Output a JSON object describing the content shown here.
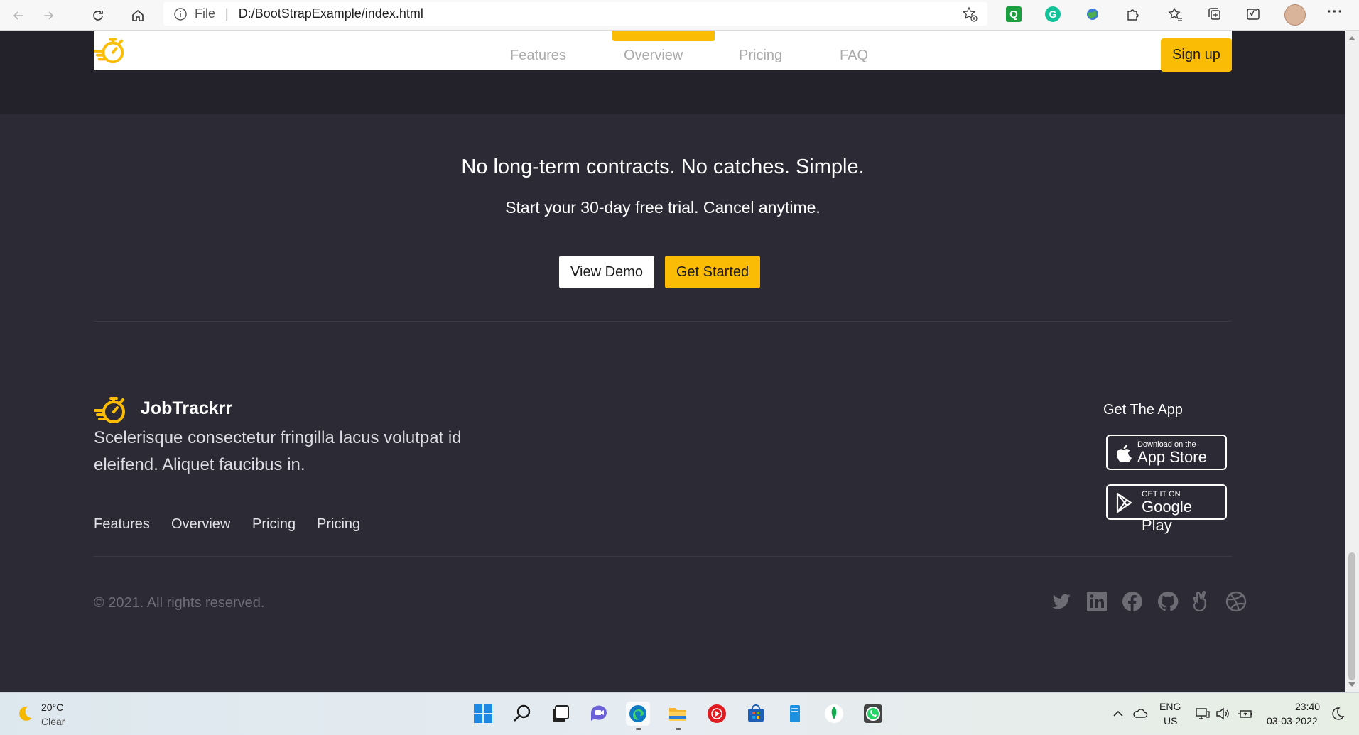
{
  "browser": {
    "address_prefix": "File",
    "address_separator": "|",
    "url": "D:/BootStrapExample/index.html",
    "extensions": {
      "q_label": "Q",
      "g_label": "G"
    },
    "more_label": "···"
  },
  "navbar": {
    "links": [
      "Features",
      "Overview",
      "Pricing",
      "FAQ"
    ],
    "active": "Overview",
    "signup_label": "Sign up"
  },
  "cta": {
    "title": "No long-term contracts. No catches. Simple.",
    "subtitle": "Start your 30-day free trial. Cancel anytime.",
    "demo_label": "View Demo",
    "start_label": "Get Started"
  },
  "footer": {
    "brand": "JobTrackrr",
    "tagline": "Scelerisque consectetur fringilla lacus volutpat id eleifend. Aliquet faucibus in.",
    "links": [
      "Features",
      "Overview",
      "Pricing",
      "Pricing"
    ],
    "get_app": "Get The App",
    "app_store": {
      "small": "Download on the",
      "big": "App Store"
    },
    "google_play": {
      "small": "GET IT ON",
      "big": "Google Play"
    },
    "copyright": "© 2021. All rights reserved.",
    "social_icons": [
      "twitter-icon",
      "linkedin-icon",
      "facebook-icon",
      "github-icon",
      "angellist-icon",
      "dribbble-icon"
    ]
  },
  "taskbar": {
    "weather_temp": "20°C",
    "weather_desc": "Clear",
    "lang_line1": "ENG",
    "lang_line2": "US",
    "time": "23:40",
    "date": "03-03-2022"
  },
  "colors": {
    "accent": "#fbbc05",
    "page_bg": "#2b2a35",
    "top_band": "#232129",
    "muted_text": "#6f6e78"
  }
}
